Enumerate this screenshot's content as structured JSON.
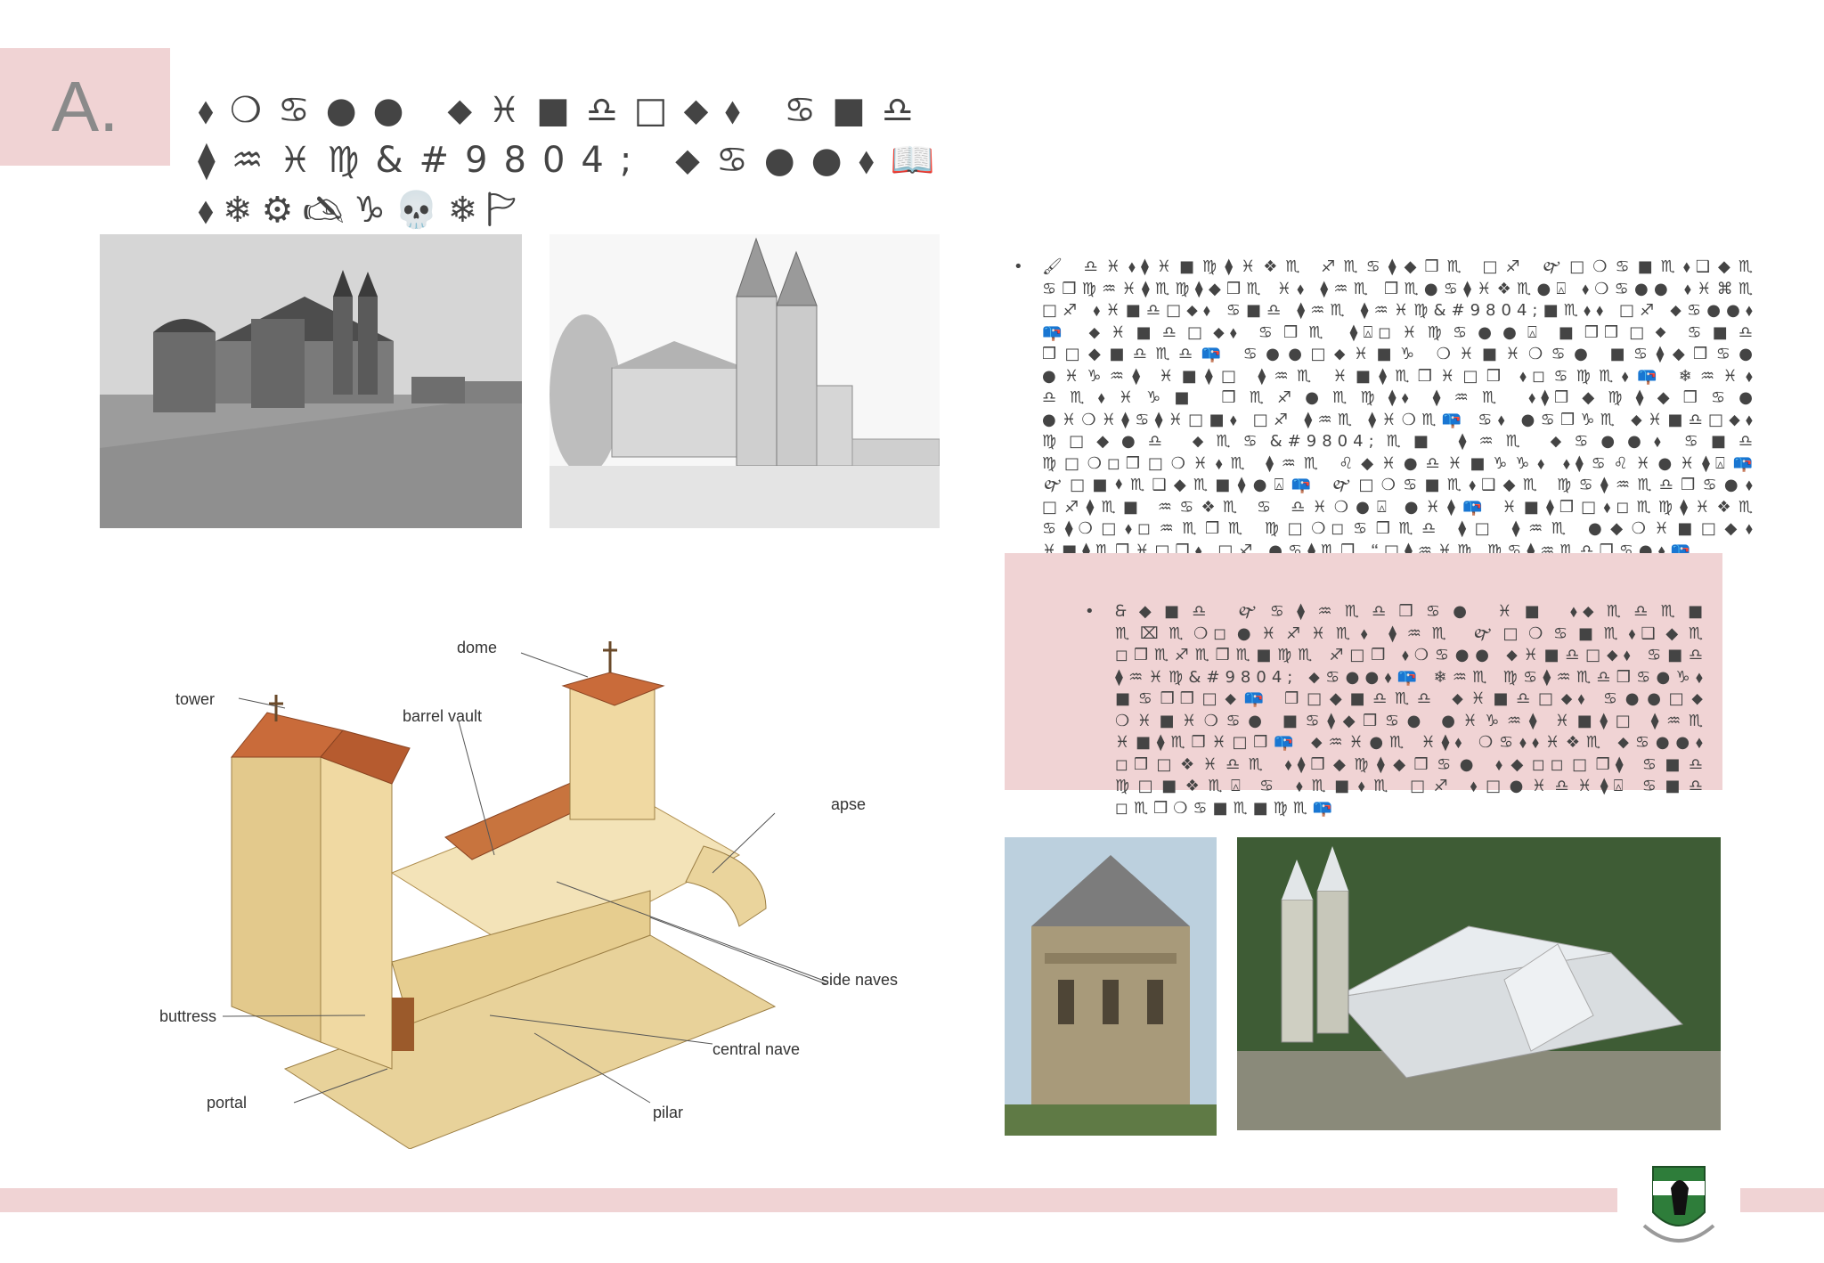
{
  "badge": {
    "letter": "A."
  },
  "title": {
    "line1": "⬧❍♋●● ⬥♓■♎□⬥⬧ ♋■♎ ⧫♒♓♍&#9804; ⬥♋●●⬧📖",
    "line2": "⬧❄⚙🖎♑💀❄🏱"
  },
  "paragraph_1": "🖌 ♎♓⬧⧫♓■♍⧫♓❖♏ ♐♏♋⧫◆❒♏ □♐ 🙰□❍♋■♏⬧❑◆♏ ♋❒♍♒♓⧫♏♍⧫◆❒♏ ♓⬧ ⧫♒♏ ❒♏●♋⧫♓❖♏●⍓ ⬧❍♋●● ⬧♓⌘♏ □♐ ⬧♓■♎□⬥⬧ ♋■♎ ⧫♒♏ ⧫♒♓♍&#9804;■♏⬧⬧ □♐ ⬥♋●●⬧📪 ⬥♓■♎□⬥⬧ ♋❒♏ ⧫⍓◻♓♍♋●●⍓ ■❒❒□⬥ ♋■♎ ❒□◆■♎♏♎📪 ♋●●□⬥♓■♑ ❍♓■♓❍♋● ■♋⧫◆❒♋● ●♓♑♒⧫ ♓■⧫□ ⧫♒♏ ♓■⧫♏❒♓□❒ ⬧◻♋♍♏⬧📪 ❄♒♓⬧ ♎♏⬧♓♑■ ❒♏♐●♏♍⧫⬧ ⧫♒♏ ⬧⧫❒◆♍⧫◆❒♋● ●♓❍♓⧫♋⧫♓□■⬧ □♐ ⧫♒♏ ⧫♓❍♏📪 ♋⬧ ●♋❒♑♏ ⬥♓■♎□⬥⬧ ♍□◆●♎ ⬥♏♋&#9804;♏■ ⧫♒♏ ⬥♋●●⬧ ♋■♎ ♍□❍◻❒□❍♓⬧♏ ⧫♒♏ ♌◆♓●♎♓■♑♑⬧ ⬧⧫♋♌♓●♓⧫⍓📪 🙰□■⬧♏❑◆♏■⧫●⍓📪 🙰□❍♋■♏⬧❑◆♏ ♍♋⧫♒♏♎❒♋●⬧ □♐⧫♏■ ♒♋❖♏ ♋ ♎♓❍●⍓ ●♓⧫📪 ♓■⧫❒□⬧◻♏♍⧫♓❖♏ ♋⧫❍□⬧◻♒♏❒♏ ♍□❍◻♋❒♏♎ ⧫□ ⧫♒♏ ●◆❍♓■□◆⬧ ♓■⧫♏❒♓□❒⬧ □♐ ●♋⧫♏❒ 🙶□⧫♒♓♍ ♍♋⧫♒♏♎❒♋●⬧📪",
  "paragraph_2": "🙲◆■♎ 🙰♋⧫♒♏♎❒♋● ♓■ ⬧⬥♏♎♏■ ♏⌧♏❍◻●♓♐♓♏⬧ ⧫♒♏ 🙰□❍♋■♏⬧❑◆♏ ◻❒♏♐♏❒♏■♍♏ ♐□❒ ⬧❍♋●● ⬥♓■♎□⬥⬧ ♋■♎ ⧫♒♓♍&#9804; ⬥♋●●⬧📪 ❄♒♏ ♍♋⧫♒♏♎❒♋●♑⬧ ■♋❒❒□⬥📪 ❒□◆■♎♏♎ ⬥♓■♎□⬥⬧ ♋●●□⬥ ❍♓■♓❍♋● ■♋⧫◆❒♋● ●♓♑♒⧫ ♓■⧫□ ⧫♒♏ ♓■⧫♏❒♓□❒📪 ⬥♒♓●♏ ♓⧫⬧ ❍♋⬧⬧♓❖♏ ⬥♋●●⬧ ◻❒□❖♓♎♏ ⬧⧫❒◆♍⧫◆❒♋● ⬧◆◻◻□❒⧫ ♋■♎ ♍□■❖♏⍓ ♋ ⬧♏■⬧♏ □♐ ⬧□●♓♎♓⧫⍓ ♋■♎ ◻♏❒❍♋■♏■♍♏📪",
  "diagram_labels": {
    "tower": "tower",
    "dome": "dome",
    "barrel_vault": "barrel vault",
    "apse": "apse",
    "side_naves": "side naves",
    "buttress": "buttress",
    "central_nave": "central nave",
    "portal": "portal",
    "pilar": "pilar"
  },
  "colors": {
    "accent_pink": "#f0d3d4",
    "text": "#444444",
    "badge_letter": "#8a8a8a"
  }
}
